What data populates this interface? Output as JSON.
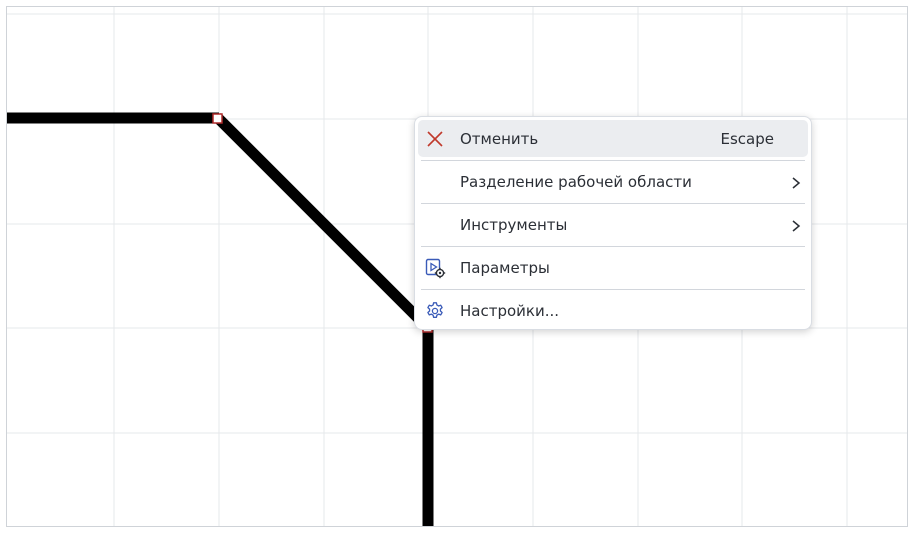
{
  "canvas": {
    "grid_color": "#e6e8eb",
    "line_color": "#000000",
    "vertex_color": "#b02a2a"
  },
  "context_menu": {
    "items": [
      {
        "label": "Отменить",
        "shortcut": "Escape",
        "icon": "close-icon",
        "icon_color": "#c0392b"
      },
      {
        "label": "Разделение рабочей области",
        "icon": "",
        "submenu": true
      },
      {
        "label": "Инструменты",
        "icon": "",
        "submenu": true
      },
      {
        "label": "Параметры",
        "icon": "parameters-icon",
        "icon_color": "#3a5bb8"
      },
      {
        "label": "Настройки...",
        "icon": "gear-icon",
        "icon_color": "#3a5bb8"
      }
    ]
  }
}
